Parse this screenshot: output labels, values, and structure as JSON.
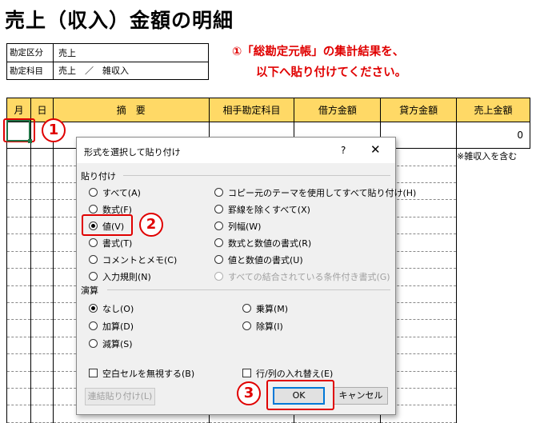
{
  "page": {
    "title": "売上（収入）金額の明細"
  },
  "info": {
    "rows": [
      {
        "key": "勘定区分",
        "value": "売上"
      },
      {
        "key": "勘定科目",
        "value": "売上　／　雑収入"
      }
    ]
  },
  "instruction": {
    "line1": "①「総勘定元帳」の集計結果を、",
    "line2": "以下へ貼り付けてください。"
  },
  "ledger": {
    "headers": [
      "月",
      "日",
      "摘　要",
      "相手勘定科目",
      "借方金額",
      "貸方金額",
      "売上金額"
    ],
    "sales_total": "0",
    "note": "※雑収入を含む"
  },
  "steps": {
    "s1": "1",
    "s2": "2",
    "s3": "3"
  },
  "dialog": {
    "title": "形式を選択して貼り付け",
    "help": "?",
    "close": "✕",
    "paste_group": "貼り付け",
    "paste_left": [
      "すべて(A)",
      "数式(F)",
      "値(V)",
      "書式(T)",
      "コメントとメモ(C)",
      "入力規則(N)"
    ],
    "paste_right": [
      "コピー元のテーマを使用してすべて貼り付け(H)",
      "罫線を除くすべて(X)",
      "列幅(W)",
      "数式と数値の書式(R)",
      "値と数値の書式(U)",
      "すべての結合されている条件付き書式(G)"
    ],
    "operation_group": "演算",
    "op_left": [
      "なし(O)",
      "加算(D)",
      "減算(S)"
    ],
    "op_right": [
      "乗算(M)",
      "除算(I)"
    ],
    "skip_blanks": "空白セルを無視する(B)",
    "transpose": "行/列の入れ替え(E)",
    "paste_link": "連結貼り付け(L)",
    "ok": "OK",
    "cancel": "キャンセル"
  },
  "colors": {
    "header_fill": "#ffd966",
    "annotation_red": "#e00000",
    "accent_blue": "#0078d7"
  }
}
